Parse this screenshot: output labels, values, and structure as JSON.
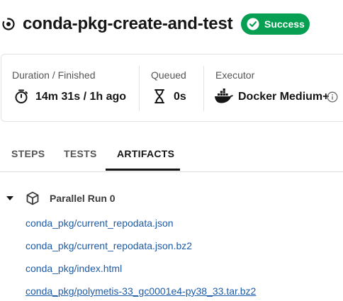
{
  "job": {
    "title": "conda-pkg-create-and-test",
    "status": "Success",
    "status_color": "#079f52"
  },
  "stats": {
    "duration_label": "Duration / Finished",
    "duration_value": "14m 31s / 1h ago",
    "queued_label": "Queued",
    "queued_value": "0s",
    "executor_label": "Executor",
    "executor_value": "Docker Medium+",
    "executor_icon": "docker-icon"
  },
  "tabs": [
    {
      "label": "STEPS",
      "active": false
    },
    {
      "label": "TESTS",
      "active": false
    },
    {
      "label": "ARTIFACTS",
      "active": true
    }
  ],
  "parallel_run": {
    "label": "Parallel Run 0",
    "expanded": true
  },
  "artifacts": [
    {
      "name": "conda_pkg/current_repodata.json",
      "underlined": false
    },
    {
      "name": "conda_pkg/current_repodata.json.bz2",
      "underlined": false
    },
    {
      "name": "conda_pkg/index.html",
      "underlined": false
    },
    {
      "name": "conda_pkg/polymetis-33_gc0001e4-py38_33.tar.bz2",
      "underlined": true
    }
  ],
  "colors": {
    "link": "#1c5ba8",
    "success": "#079f52"
  }
}
